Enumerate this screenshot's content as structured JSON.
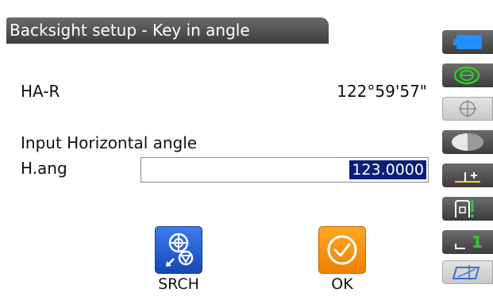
{
  "title": "Backsight setup - Key in angle",
  "ha": {
    "label": "HA-R",
    "value": "122°59'57\""
  },
  "input": {
    "heading": "Input Horizontal angle",
    "label": "H.ang",
    "value": "123.0000"
  },
  "softkeys": {
    "srch": "SRCH",
    "ok": "OK"
  },
  "side_panel": {
    "icons": [
      "battery-icon",
      "tilt-icon",
      "target-icon",
      "laser-icon",
      "prism-const-icon",
      "ppm-icon",
      "face-icon",
      "cursor-icon"
    ],
    "tilt_partial": "(",
    "face_number": "1"
  },
  "colors": {
    "title_bg": "#4a4a4a",
    "selection": "#0a1f7a",
    "srch_blue": "#1f5bd6",
    "ok_orange": "#f58a00",
    "icon_green": "#2ecc2e"
  }
}
